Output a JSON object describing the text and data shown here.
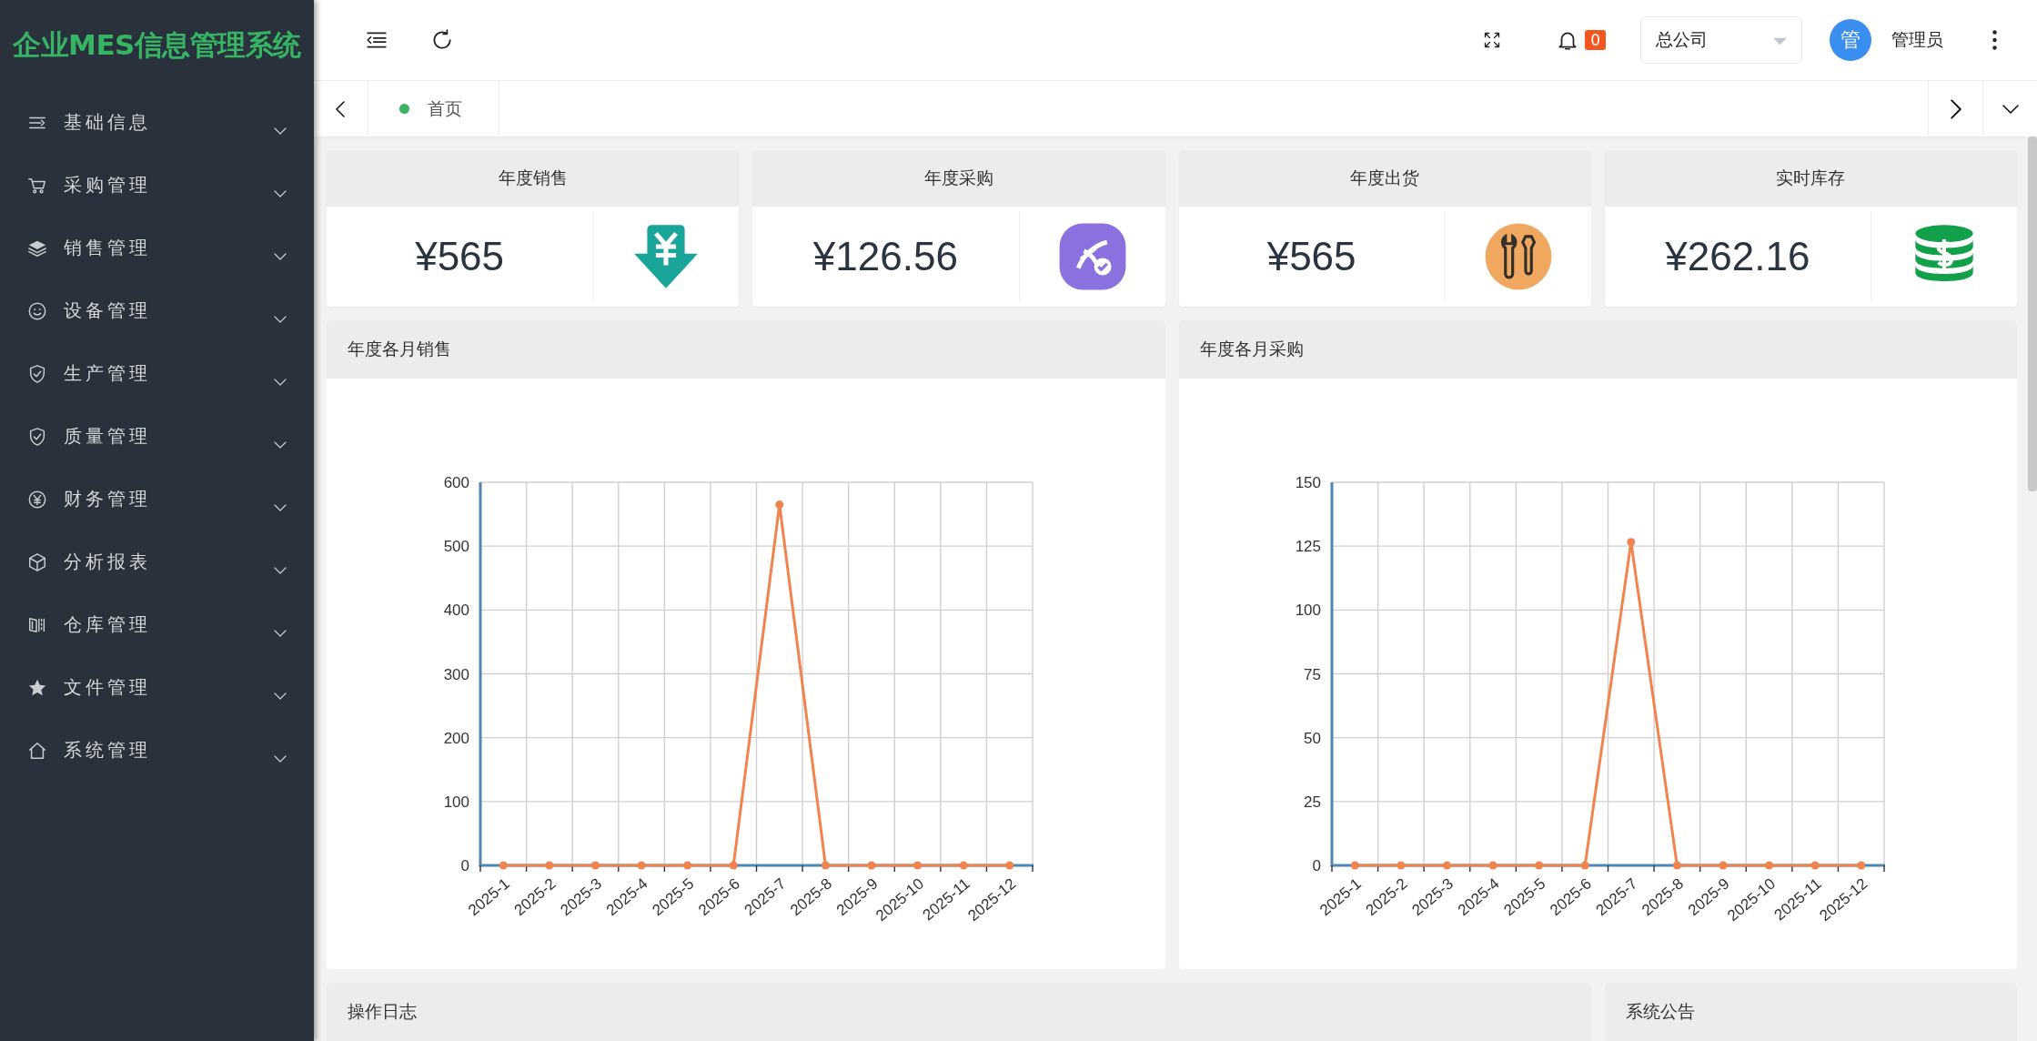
{
  "sidebar": {
    "title": "企业MES信息管理系统",
    "items": [
      {
        "label": "基础信息",
        "expanded": false
      },
      {
        "label": "采购管理",
        "expanded": false
      },
      {
        "label": "销售管理",
        "expanded": false
      },
      {
        "label": "设备管理",
        "expanded": false
      },
      {
        "label": "生产管理",
        "expanded": false
      },
      {
        "label": "质量管理",
        "expanded": false
      },
      {
        "label": "财务管理",
        "expanded": false
      },
      {
        "label": "分析报表",
        "expanded": false
      },
      {
        "label": "仓库管理",
        "expanded": false
      },
      {
        "label": "文件管理",
        "expanded": false
      },
      {
        "label": "系统管理",
        "expanded": false
      }
    ]
  },
  "header": {
    "notification_count": "0",
    "company_select": {
      "value": "总公司"
    },
    "avatar_text": "管",
    "user_name": "管理员"
  },
  "tabs": [
    {
      "label": "首页",
      "selected": true
    }
  ],
  "stat_cards": [
    {
      "title": "年度销售",
      "value": "¥565"
    },
    {
      "title": "年度采购",
      "value": "¥126.56"
    },
    {
      "title": "年度出货",
      "value": "¥565"
    },
    {
      "title": "实时库存",
      "value": "¥262.16"
    }
  ],
  "chart_panels": [
    {
      "title": "年度各月销售",
      "chart_data": {
        "type": "line",
        "categories": [
          "2025-1",
          "2025-2",
          "2025-3",
          "2025-4",
          "2025-5",
          "2025-6",
          "2025-7",
          "2025-8",
          "2025-9",
          "2025-10",
          "2025-11",
          "2025-12"
        ],
        "ylim": [
          0,
          600
        ],
        "yticks": [
          0,
          100,
          200,
          300,
          400,
          500,
          600
        ],
        "grid": true,
        "series": [
          {
            "color": "#f0834e",
            "marker": true,
            "values": [
              0,
              0,
              0,
              0,
              0,
              0,
              565,
              0,
              0,
              0,
              0,
              0
            ]
          }
        ]
      }
    },
    {
      "title": "年度各月采购",
      "chart_data": {
        "type": "line",
        "categories": [
          "2025-1",
          "2025-2",
          "2025-3",
          "2025-4",
          "2025-5",
          "2025-6",
          "2025-7",
          "2025-8",
          "2025-9",
          "2025-10",
          "2025-11",
          "2025-12"
        ],
        "ylim": [
          0,
          150
        ],
        "yticks": [
          0,
          25,
          50,
          75,
          100,
          125,
          150
        ],
        "grid": true,
        "series": [
          {
            "color": "#f0834e",
            "marker": true,
            "values": [
              0,
              0,
              0,
              0,
              0,
              0,
              126.56,
              0,
              0,
              0,
              0,
              0
            ]
          }
        ]
      }
    }
  ],
  "bottom_panels": [
    {
      "title": "操作日志"
    },
    {
      "title": "系统公告"
    }
  ]
}
